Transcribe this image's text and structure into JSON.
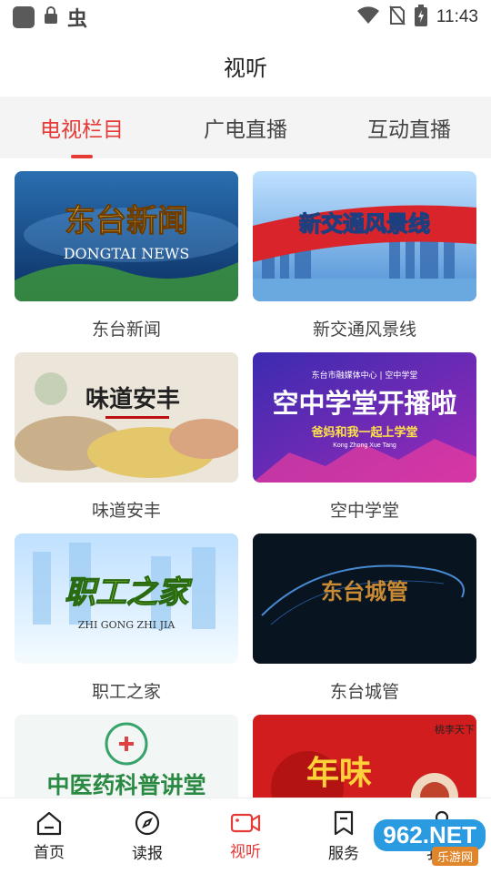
{
  "status_bar": {
    "time": "11:43",
    "app_glyph": "虫"
  },
  "page_title": "视听",
  "tabs": [
    {
      "label": "电视栏目",
      "active": true
    },
    {
      "label": "广电直播",
      "active": false
    },
    {
      "label": "互动直播",
      "active": false
    }
  ],
  "programs": [
    {
      "title": "东台新闻",
      "thumb_title": "东台新闻",
      "thumb_sub": "DONGTAI NEWS"
    },
    {
      "title": "新交通风景线",
      "thumb_title": "新交通风景线"
    },
    {
      "title": "味道安丰",
      "thumb_title": "味道安丰"
    },
    {
      "title": "空中学堂",
      "thumb_title": "空中学堂开播啦",
      "thumb_top": "东台市融媒体中心 | 空中学堂",
      "thumb_slogan": "爸妈和我一起上学堂",
      "thumb_pinyin": "Kong Zhong Xue Tang"
    },
    {
      "title": "职工之家",
      "thumb_title": "职工之家",
      "thumb_sub": "ZHI GONG ZHI JIA"
    },
    {
      "title": "东台城管",
      "thumb_title": "东台城管"
    },
    {
      "title": "",
      "thumb_title": "中医药科普讲堂"
    },
    {
      "title": "",
      "thumb_title": "年味",
      "thumb_corner": "桃李天下"
    }
  ],
  "bottom_nav": [
    {
      "label": "首页",
      "icon": "home-icon",
      "active": false
    },
    {
      "label": "读报",
      "icon": "compass-icon",
      "active": false
    },
    {
      "label": "视听",
      "icon": "video-camera-icon",
      "active": true
    },
    {
      "label": "服务",
      "icon": "bookmark-icon",
      "active": false
    },
    {
      "label": "我的",
      "icon": "user-icon",
      "active": false
    }
  ],
  "watermark": {
    "main": "962.NET",
    "sub": "乐游网"
  },
  "colors": {
    "accent": "#e63a36",
    "tab_bg": "#f4f4f4"
  }
}
